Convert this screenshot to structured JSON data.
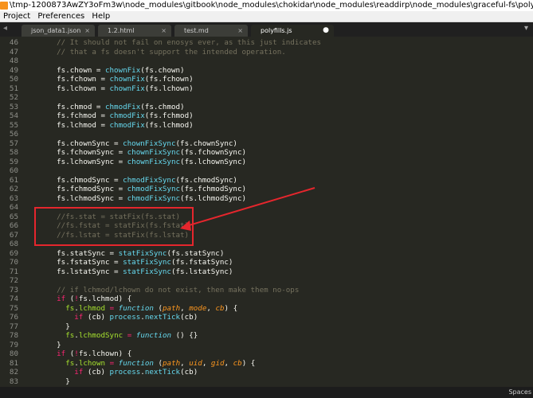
{
  "window": {
    "title": "\\tmp-1200873AwZY3oFm3w\\node_modules\\gitbook\\node_modules\\chokidar\\node_modules\\readdirp\\node_modules\\graceful-fs\\polyfills.js • (前端练习) - Sublime Text (UNREGISTERED)"
  },
  "menu": [
    "Project",
    "Preferences",
    "Help"
  ],
  "tabs": [
    {
      "label": "json_data1.json",
      "active": false
    },
    {
      "label": "1.2.html",
      "active": false
    },
    {
      "label": "test.md",
      "active": false
    },
    {
      "label": "polyfills.js",
      "active": true
    }
  ],
  "tab_close_glyph": "×",
  "tab_modified_glyph": "●",
  "status": {
    "indent": "Spaces"
  },
  "annotation": {
    "box_color": "#e5262d",
    "arrow_color": "#e5262d"
  },
  "code_lines": [
    {
      "n": "46",
      "t": [
        [
          "    ",
          "p"
        ],
        [
          "// It should not fail on enosys ever, as this just indicates",
          "c"
        ]
      ]
    },
    {
      "n": "47",
      "t": [
        [
          "    ",
          "p"
        ],
        [
          "// that a fs doesn't support the intended operation.",
          "c"
        ]
      ]
    },
    {
      "n": "48",
      "t": []
    },
    {
      "n": "49",
      "t": [
        [
          "    fs.chown = ",
          "p"
        ],
        [
          "chownFix",
          "f"
        ],
        [
          "(fs.chown)",
          "p"
        ]
      ]
    },
    {
      "n": "50",
      "t": [
        [
          "    fs.fchown = ",
          "p"
        ],
        [
          "chownFix",
          "f"
        ],
        [
          "(fs.fchown)",
          "p"
        ]
      ]
    },
    {
      "n": "51",
      "t": [
        [
          "    fs.lchown = ",
          "p"
        ],
        [
          "chownFix",
          "f"
        ],
        [
          "(fs.lchown)",
          "p"
        ]
      ]
    },
    {
      "n": "52",
      "t": []
    },
    {
      "n": "53",
      "t": [
        [
          "    fs.chmod = ",
          "p"
        ],
        [
          "chmodFix",
          "f"
        ],
        [
          "(fs.chmod)",
          "p"
        ]
      ]
    },
    {
      "n": "54",
      "t": [
        [
          "    fs.fchmod = ",
          "p"
        ],
        [
          "chmodFix",
          "f"
        ],
        [
          "(fs.fchmod)",
          "p"
        ]
      ]
    },
    {
      "n": "55",
      "t": [
        [
          "    fs.lchmod = ",
          "p"
        ],
        [
          "chmodFix",
          "f"
        ],
        [
          "(fs.lchmod)",
          "p"
        ]
      ]
    },
    {
      "n": "56",
      "t": []
    },
    {
      "n": "57",
      "t": [
        [
          "    fs.chownSync = ",
          "p"
        ],
        [
          "chownFixSync",
          "f"
        ],
        [
          "(fs.chownSync)",
          "p"
        ]
      ]
    },
    {
      "n": "58",
      "t": [
        [
          "    fs.fchownSync = ",
          "p"
        ],
        [
          "chownFixSync",
          "f"
        ],
        [
          "(fs.fchownSync)",
          "p"
        ]
      ]
    },
    {
      "n": "59",
      "t": [
        [
          "    fs.lchownSync = ",
          "p"
        ],
        [
          "chownFixSync",
          "f"
        ],
        [
          "(fs.lchownSync)",
          "p"
        ]
      ]
    },
    {
      "n": "60",
      "t": []
    },
    {
      "n": "61",
      "t": [
        [
          "    fs.chmodSync = ",
          "p"
        ],
        [
          "chmodFixSync",
          "f"
        ],
        [
          "(fs.chmodSync)",
          "p"
        ]
      ]
    },
    {
      "n": "62",
      "t": [
        [
          "    fs.fchmodSync = ",
          "p"
        ],
        [
          "chmodFixSync",
          "f"
        ],
        [
          "(fs.fchmodSync)",
          "p"
        ]
      ]
    },
    {
      "n": "63",
      "t": [
        [
          "    fs.lchmodSync = ",
          "p"
        ],
        [
          "chmodFixSync",
          "f"
        ],
        [
          "(fs.lchmodSync)",
          "p"
        ]
      ]
    },
    {
      "n": "64",
      "t": []
    },
    {
      "n": "65",
      "t": [
        [
          "    ",
          "p"
        ],
        [
          "//fs.stat = statFix(fs.stat)",
          "c"
        ]
      ]
    },
    {
      "n": "66",
      "t": [
        [
          "    ",
          "p"
        ],
        [
          "//fs.fstat = statFix(fs.fstat)",
          "c"
        ]
      ]
    },
    {
      "n": "67",
      "t": [
        [
          "    ",
          "p"
        ],
        [
          "//fs.lstat = statFix(fs.lstat)",
          "c"
        ]
      ]
    },
    {
      "n": "68",
      "t": []
    },
    {
      "n": "69",
      "t": [
        [
          "    fs.statSync = ",
          "p"
        ],
        [
          "statFixSync",
          "f"
        ],
        [
          "(fs.statSync)",
          "p"
        ]
      ]
    },
    {
      "n": "70",
      "t": [
        [
          "    fs.fstatSync = ",
          "p"
        ],
        [
          "statFixSync",
          "f"
        ],
        [
          "(fs.fstatSync)",
          "p"
        ]
      ]
    },
    {
      "n": "71",
      "t": [
        [
          "    fs.lstatSync = ",
          "p"
        ],
        [
          "statFixSync",
          "f"
        ],
        [
          "(fs.lstatSync)",
          "p"
        ]
      ]
    },
    {
      "n": "72",
      "t": []
    },
    {
      "n": "73",
      "t": [
        [
          "    ",
          "p"
        ],
        [
          "// if lchmod/lchown do not exist, then make them no-ops",
          "c"
        ]
      ]
    },
    {
      "n": "74",
      "t": [
        [
          "    ",
          "p"
        ],
        [
          "if",
          "k"
        ],
        [
          " (",
          "p"
        ],
        [
          "!",
          "k"
        ],
        [
          "fs.lchmod) {",
          "p"
        ]
      ]
    },
    {
      "n": "75",
      "t": [
        [
          "      ",
          "p"
        ],
        [
          "fs",
          "i"
        ],
        [
          ".",
          "p"
        ],
        [
          "lchmod",
          "i"
        ],
        [
          " ",
          "p"
        ],
        [
          "=",
          "k"
        ],
        [
          " ",
          "p"
        ],
        [
          "function",
          "F"
        ],
        [
          " (",
          "p"
        ],
        [
          "path",
          "a"
        ],
        [
          ", ",
          "p"
        ],
        [
          "mode",
          "a"
        ],
        [
          ", ",
          "p"
        ],
        [
          "cb",
          "a"
        ],
        [
          ") {",
          "p"
        ]
      ]
    },
    {
      "n": "76",
      "t": [
        [
          "        ",
          "p"
        ],
        [
          "if",
          "k"
        ],
        [
          " (cb) ",
          "p"
        ],
        [
          "process",
          "f"
        ],
        [
          ".",
          "p"
        ],
        [
          "nextTick",
          "f"
        ],
        [
          "(cb)",
          "p"
        ]
      ]
    },
    {
      "n": "77",
      "t": [
        [
          "      }",
          "p"
        ]
      ]
    },
    {
      "n": "78",
      "t": [
        [
          "      ",
          "p"
        ],
        [
          "fs",
          "i"
        ],
        [
          ".",
          "p"
        ],
        [
          "lchmodSync",
          "i"
        ],
        [
          " ",
          "p"
        ],
        [
          "=",
          "k"
        ],
        [
          " ",
          "p"
        ],
        [
          "function",
          "F"
        ],
        [
          " () {}",
          "p"
        ]
      ]
    },
    {
      "n": "79",
      "t": [
        [
          "    }",
          "p"
        ]
      ]
    },
    {
      "n": "80",
      "t": [
        [
          "    ",
          "p"
        ],
        [
          "if",
          "k"
        ],
        [
          " (",
          "p"
        ],
        [
          "!",
          "k"
        ],
        [
          "fs.lchown) {",
          "p"
        ]
      ]
    },
    {
      "n": "81",
      "t": [
        [
          "      ",
          "p"
        ],
        [
          "fs",
          "i"
        ],
        [
          ".",
          "p"
        ],
        [
          "lchown",
          "i"
        ],
        [
          " ",
          "p"
        ],
        [
          "=",
          "k"
        ],
        [
          " ",
          "p"
        ],
        [
          "function",
          "F"
        ],
        [
          " (",
          "p"
        ],
        [
          "path",
          "a"
        ],
        [
          ", ",
          "p"
        ],
        [
          "uid",
          "a"
        ],
        [
          ", ",
          "p"
        ],
        [
          "gid",
          "a"
        ],
        [
          ", ",
          "p"
        ],
        [
          "cb",
          "a"
        ],
        [
          ") {",
          "p"
        ]
      ]
    },
    {
      "n": "82",
      "t": [
        [
          "        ",
          "p"
        ],
        [
          "if",
          "k"
        ],
        [
          " (cb) ",
          "p"
        ],
        [
          "process",
          "f"
        ],
        [
          ".",
          "p"
        ],
        [
          "nextTick",
          "f"
        ],
        [
          "(cb)",
          "p"
        ]
      ]
    },
    {
      "n": "83",
      "t": [
        [
          "      }",
          "p"
        ]
      ]
    }
  ]
}
